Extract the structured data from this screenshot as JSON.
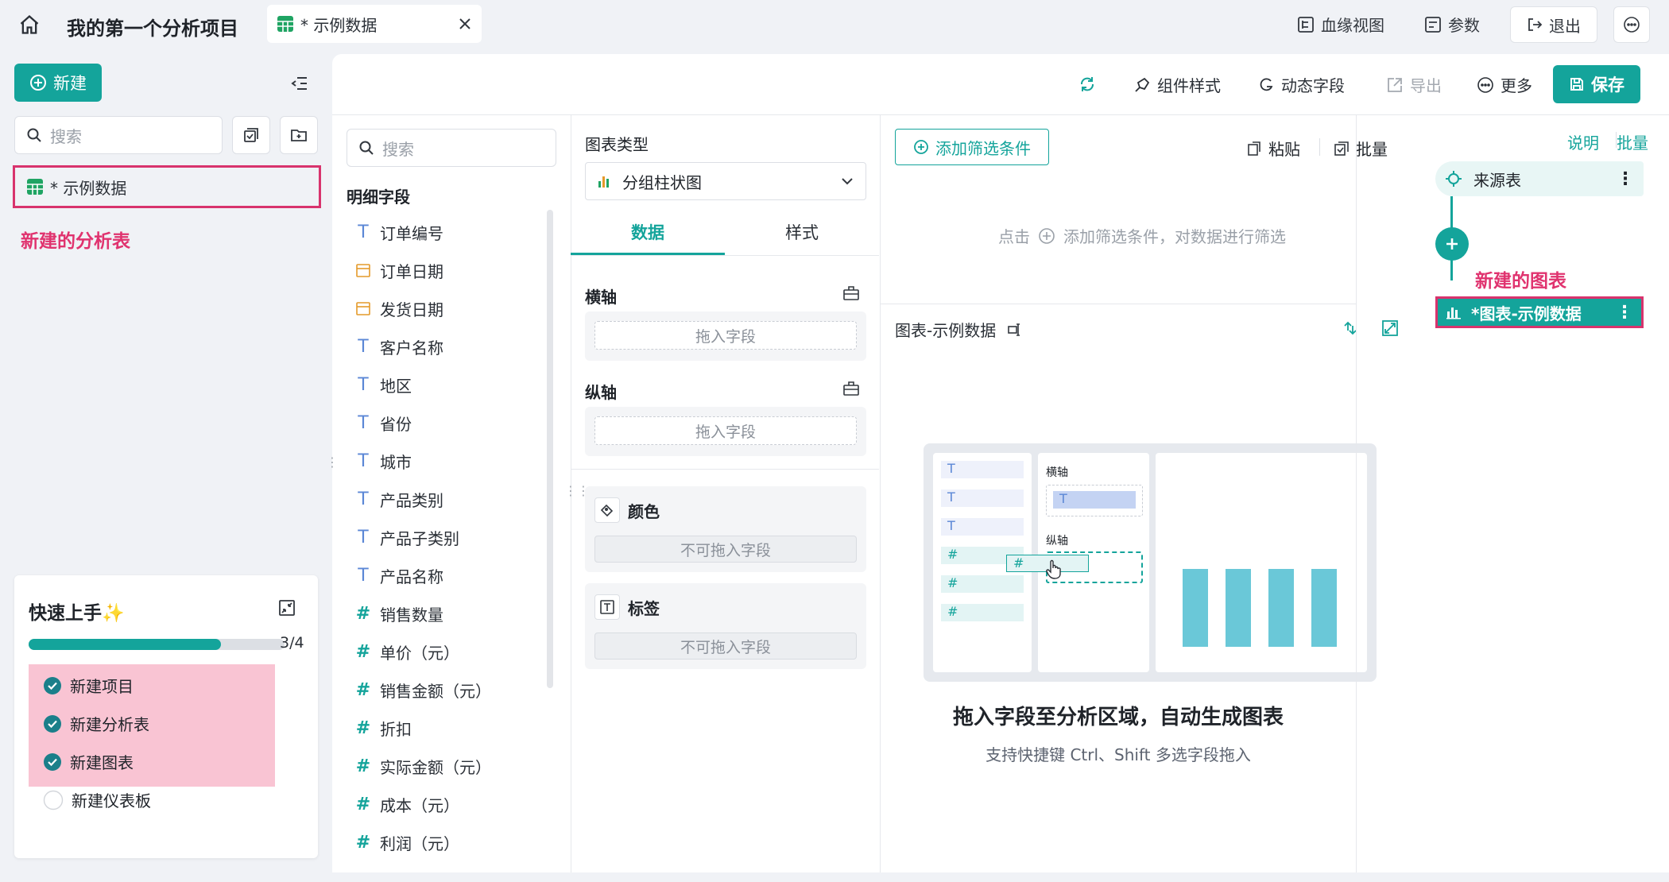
{
  "topbar": {
    "project_title": "我的第一个分析项目",
    "tab_label": "* 示例数据",
    "lineage_label": "血缘视图",
    "params_label": "参数",
    "exit_label": "退出"
  },
  "sidebar": {
    "new_label": "新建",
    "search_placeholder": "搜索",
    "items": [
      {
        "label": "* 示例数据"
      }
    ],
    "annotation": "新建的分析表"
  },
  "quickstart": {
    "title": "快速上手✨",
    "progress_text": "3/4",
    "progress_fraction": 0.75,
    "steps": [
      {
        "label": "新建项目",
        "done": true
      },
      {
        "label": "新建分析表",
        "done": true
      },
      {
        "label": "新建图表",
        "done": true
      },
      {
        "label": "新建仪表板",
        "done": false
      }
    ]
  },
  "toolbar": {
    "component_style": "组件样式",
    "dynamic_field": "动态字段",
    "export": "导出",
    "more": "更多",
    "save": "保存"
  },
  "fields": {
    "search_placeholder": "搜索",
    "section_title": "明细字段",
    "items": [
      {
        "type": "text",
        "label": "订单编号"
      },
      {
        "type": "date",
        "label": "订单日期"
      },
      {
        "type": "date",
        "label": "发货日期"
      },
      {
        "type": "text",
        "label": "客户名称"
      },
      {
        "type": "text",
        "label": "地区"
      },
      {
        "type": "text",
        "label": "省份"
      },
      {
        "type": "text",
        "label": "城市"
      },
      {
        "type": "text",
        "label": "产品类别"
      },
      {
        "type": "text",
        "label": "产品子类别"
      },
      {
        "type": "text",
        "label": "产品名称"
      },
      {
        "type": "number",
        "label": "销售数量"
      },
      {
        "type": "number",
        "label": "单价（元）"
      },
      {
        "type": "number",
        "label": "销售金额（元）"
      },
      {
        "type": "number",
        "label": "折扣"
      },
      {
        "type": "number",
        "label": "实际金额（元）"
      },
      {
        "type": "number",
        "label": "成本（元）"
      },
      {
        "type": "number",
        "label": "利润（元）"
      }
    ]
  },
  "config": {
    "chart_type_label": "图表类型",
    "chart_type_value": "分组柱状图",
    "tab_data": "数据",
    "tab_style": "样式",
    "x_axis": "横轴",
    "y_axis": "纵轴",
    "drop_hint": "拖入字段",
    "color": "颜色",
    "label": "标签",
    "no_drop": "不可拖入字段"
  },
  "filter": {
    "add_button": "添加筛选条件",
    "paste": "粘贴",
    "batch": "批量",
    "hint_prefix": "点击",
    "hint_suffix": "添加筛选条件，对数据进行筛选"
  },
  "chart": {
    "title": "图表-示例数据",
    "illus_x_label": "横轴",
    "illus_y_label": "纵轴",
    "empty_title": "拖入字段至分析区域，自动生成图表",
    "empty_sub": "支持快捷键 Ctrl、Shift 多选字段拖入"
  },
  "rightpanel": {
    "explain": "说明",
    "batch": "批量",
    "source_label": "来源表",
    "annotation": "新建的图表",
    "chart_item": "*图表-示例数据"
  },
  "colors": {
    "accent": "#14a49b",
    "annotation": "#e0336f",
    "highlight_bg": "#f9c4d3"
  }
}
